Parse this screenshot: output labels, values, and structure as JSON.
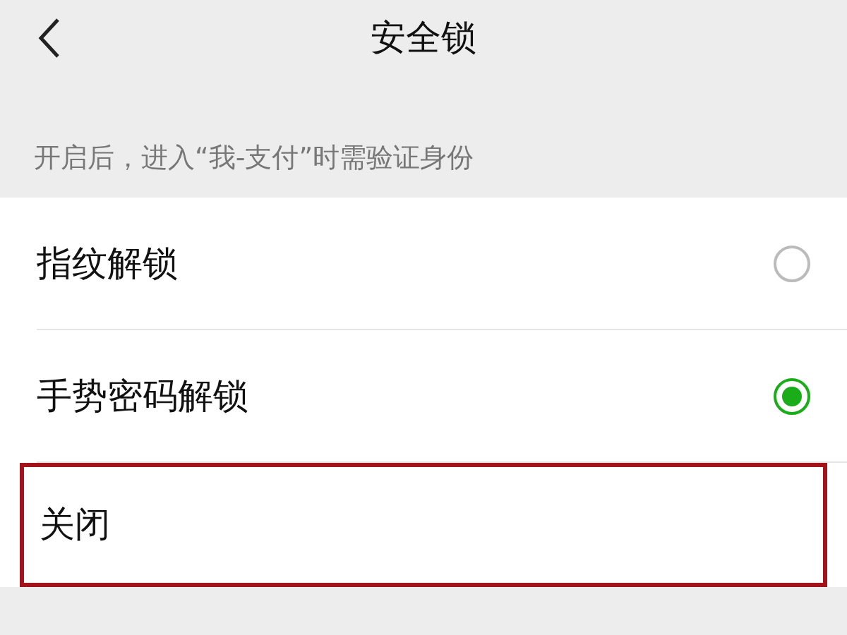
{
  "header": {
    "title": "安全锁"
  },
  "hint": "开启后，进入“我-支付”时需验证身份",
  "options": [
    {
      "label": "指纹解锁",
      "selected": false,
      "highlighted": false
    },
    {
      "label": "手势密码解锁",
      "selected": true,
      "highlighted": false
    },
    {
      "label": "关闭",
      "highlighted": true
    }
  ]
}
